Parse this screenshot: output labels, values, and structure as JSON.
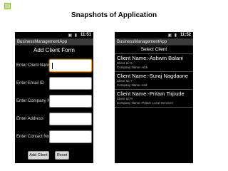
{
  "slide": {
    "title": "Snapshots of Application"
  },
  "phone_left": {
    "status_time": "11:51",
    "status_icons": "▣ ▮",
    "app_title": "BusinessManagementApp",
    "form_title": "Add Client Form",
    "fields": [
      {
        "label": "Enter Client Name",
        "value": ""
      },
      {
        "label": "Enter Email ID",
        "value": ""
      },
      {
        "label": "Enter Company Name",
        "value": ""
      },
      {
        "label": "Enter Address",
        "value": ""
      },
      {
        "label": "Enter Contact No.",
        "value": ""
      }
    ],
    "add_button": "Add Client",
    "reset_button": "Reset"
  },
  "phone_right": {
    "status_time": "11:52",
    "status_icons": "▣ ▮",
    "app_title": "BusinessManagementApp",
    "select_title": "Select Client",
    "clients": [
      {
        "name": "Client Name:-Ashwin Balani",
        "id": "Client Id:-5",
        "company": "Company Name:-Abb"
      },
      {
        "name": "Client Name:-Suraj Nagdaone",
        "id": "Client Id:-7",
        "company": "Company Name:-ssd"
      },
      {
        "name": "Client Name:-Pritam Tirpude",
        "id": "Client Id:-8",
        "company": "Company Name:-Pritam Local Services"
      }
    ]
  },
  "colors": {
    "accent_focus": "#f5a300",
    "bullet": "#9bbb59"
  }
}
